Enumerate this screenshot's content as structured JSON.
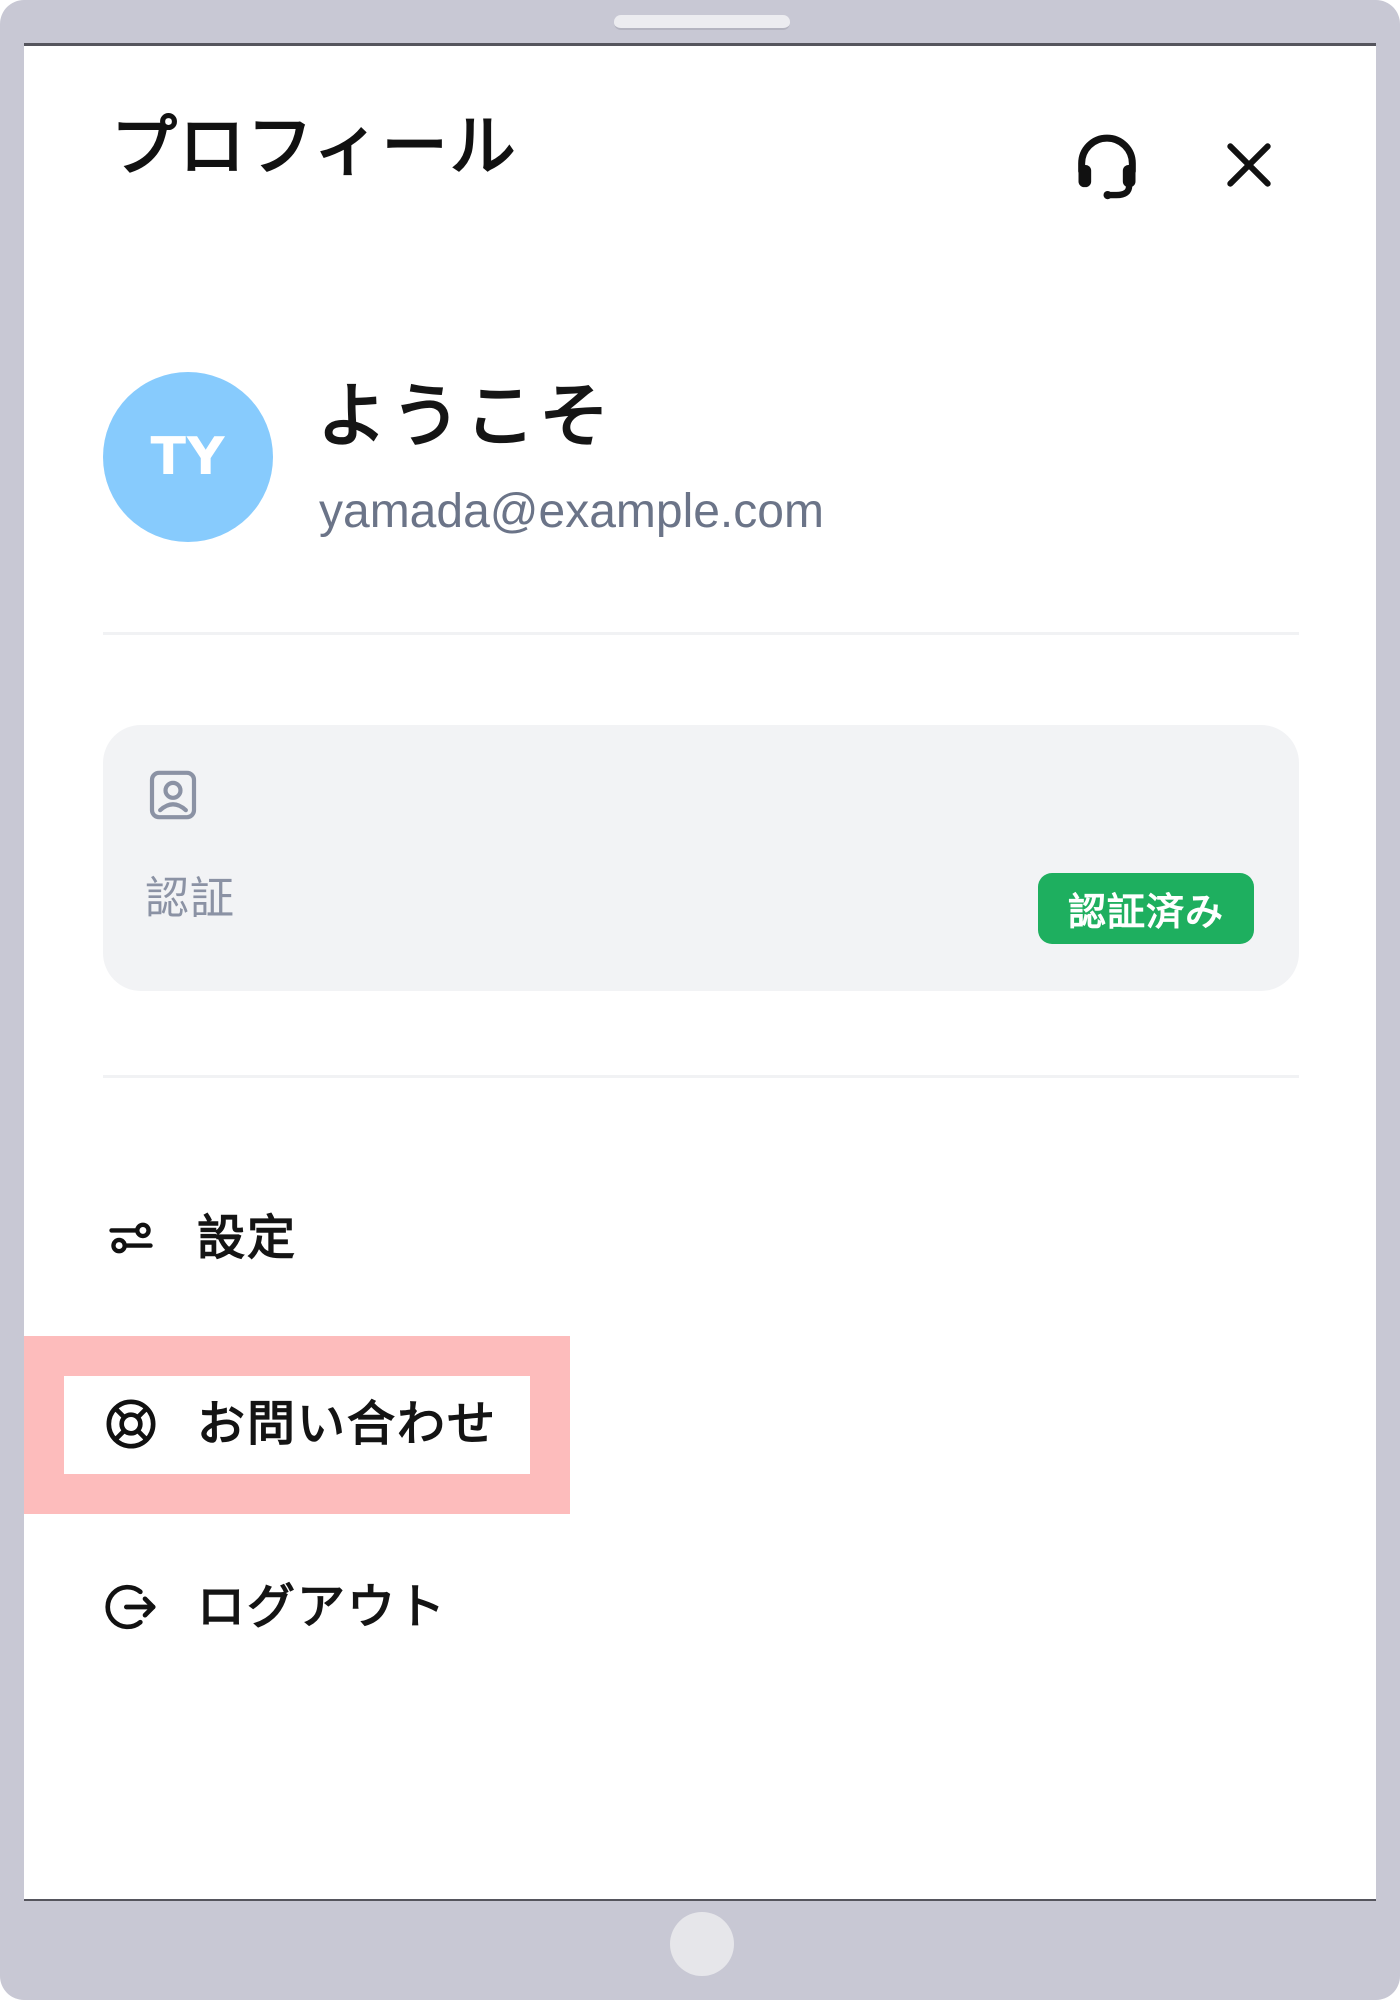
{
  "header": {
    "title": "プロフィール",
    "support_icon": "headset-icon",
    "close_icon": "close-icon"
  },
  "profile": {
    "initials": "TY",
    "welcome": "ようこそ",
    "email": "yamada@example.com",
    "avatar_color": "#87cbfd"
  },
  "verification": {
    "icon": "id-card-icon",
    "label": "認証",
    "status": "認証済み",
    "status_color": "#1eaf5f"
  },
  "menu": [
    {
      "label": "設定",
      "icon": "settings-sliders-icon"
    },
    {
      "label": "お問い合わせ",
      "icon": "lifebuoy-icon"
    },
    {
      "label": "ログアウト",
      "icon": "logout-icon"
    }
  ],
  "highlight_color": "#fdbcbc"
}
